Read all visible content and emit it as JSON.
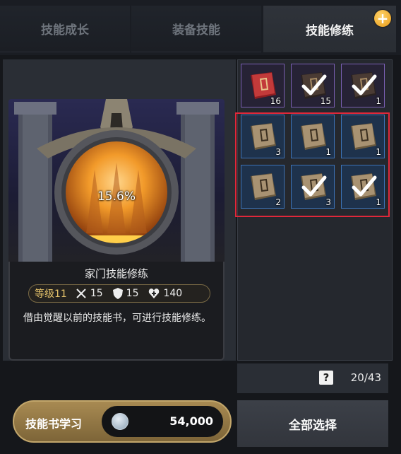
{
  "tabs": [
    {
      "label": "技能成长",
      "active": false
    },
    {
      "label": "装备技能",
      "active": false
    },
    {
      "label": "技能修练",
      "active": true
    }
  ],
  "plus_button": {
    "icon": "plus-icon",
    "label": "+"
  },
  "skill_card": {
    "progress_percent": "15.6%",
    "progress_value": 0.156,
    "title": "家门技能修练",
    "level": "等级11",
    "stats": [
      {
        "icon": "crossed-swords-icon",
        "value": "15"
      },
      {
        "icon": "shield-icon",
        "value": "15"
      },
      {
        "icon": "heart-plus-icon",
        "value": "140"
      }
    ],
    "description": "借由觉醒以前的技能书，可进行技能修练。"
  },
  "books": [
    {
      "kind": "red-book",
      "rarity": "purple",
      "count": "16",
      "checked": false
    },
    {
      "kind": "dark-book",
      "rarity": "purple",
      "count": "15",
      "checked": true
    },
    {
      "kind": "dark-book",
      "rarity": "purple",
      "count": "1",
      "checked": true
    },
    {
      "kind": "tan-book",
      "rarity": "blue",
      "count": "3",
      "checked": false
    },
    {
      "kind": "tan-book",
      "rarity": "blue",
      "count": "1",
      "checked": false
    },
    {
      "kind": "tan-book",
      "rarity": "blue",
      "count": "1",
      "checked": false
    },
    {
      "kind": "tan-book",
      "rarity": "blue",
      "count": "2",
      "checked": false
    },
    {
      "kind": "tan-book",
      "rarity": "blue",
      "count": "3",
      "checked": true
    },
    {
      "kind": "tan-book",
      "rarity": "blue",
      "count": "1",
      "checked": true
    }
  ],
  "inventory": {
    "help_icon": "?",
    "capacity": "20/43"
  },
  "select_all_label": "全部选择",
  "study": {
    "label": "技能书学习",
    "cost": "54,000",
    "currency_icon": "silver-coin-icon"
  },
  "colors": {
    "accent_gold": "#c2a66b",
    "highlight_red": "#e0283a",
    "active_tab": "#2f333a"
  }
}
